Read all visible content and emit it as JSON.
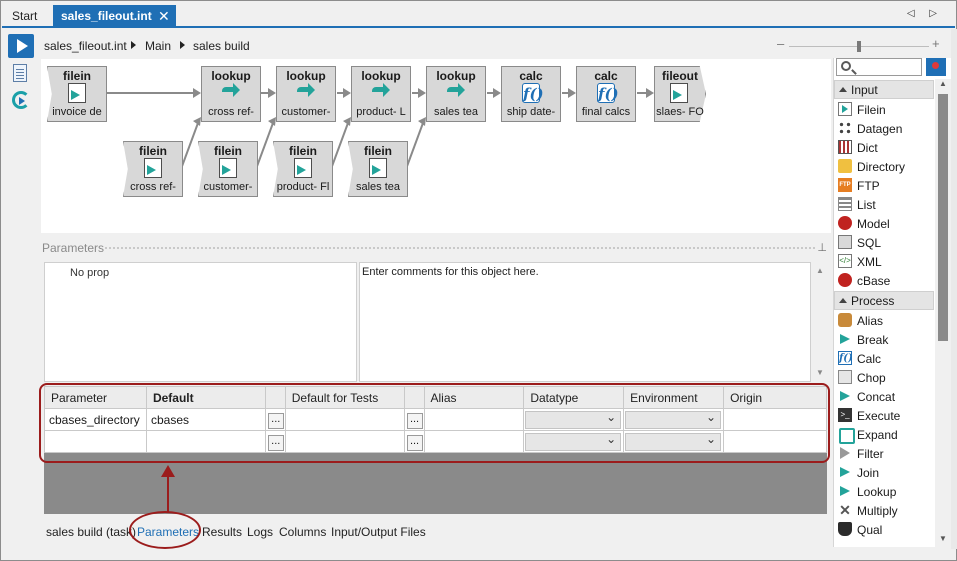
{
  "tabs": {
    "start": "Start",
    "active": "sales_fileout.int",
    "close": "✕",
    "nav": "◁ ▷"
  },
  "breadcrumb": [
    "sales_fileout.int",
    "Main",
    "sales build"
  ],
  "zoom": {
    "minus": "–",
    "plus": "+"
  },
  "graph": {
    "nodes": [
      {
        "id": "n1",
        "type": "filein",
        "title": "filein",
        "label": "invoice de",
        "icon": "file-arrow-icon"
      },
      {
        "id": "n2",
        "type": "lookup",
        "title": "lookup",
        "label": "cross ref-",
        "icon": "lookup-arrow-icon"
      },
      {
        "id": "n3",
        "type": "lookup",
        "title": "lookup",
        "label": "customer-",
        "icon": "lookup-arrow-icon"
      },
      {
        "id": "n4",
        "type": "lookup",
        "title": "lookup",
        "label": "product- L",
        "icon": "lookup-arrow-icon"
      },
      {
        "id": "n5",
        "type": "lookup",
        "title": "lookup",
        "label": "sales tea",
        "icon": "lookup-arrow-icon"
      },
      {
        "id": "n6",
        "type": "calc",
        "title": "calc",
        "label": "ship date-",
        "icon": "calc-fx-icon",
        "glyph": "f()"
      },
      {
        "id": "n7",
        "type": "calc",
        "title": "calc",
        "label": "final calcs",
        "icon": "calc-fx-icon",
        "glyph": "f()"
      },
      {
        "id": "n8",
        "type": "fileout",
        "title": "fileout",
        "label": "slaes- FO",
        "icon": "file-arrow-icon"
      },
      {
        "id": "n9",
        "type": "filein",
        "title": "filein",
        "label": "cross ref-",
        "icon": "file-arrow-icon"
      },
      {
        "id": "n10",
        "type": "filein",
        "title": "filein",
        "label": "customer-",
        "icon": "file-arrow-icon"
      },
      {
        "id": "n11",
        "type": "filein",
        "title": "filein",
        "label": "product- Fl",
        "icon": "file-arrow-icon"
      },
      {
        "id": "n12",
        "type": "filein",
        "title": "filein",
        "label": "sales tea",
        "icon": "file-arrow-icon"
      }
    ]
  },
  "parameters_panel": {
    "header": "Parameters",
    "no_props": "No prop",
    "comment": "Enter comments for this object here."
  },
  "grid": {
    "columns": [
      "Parameter",
      "Default",
      "",
      "Default for Tests",
      "",
      "Alias",
      "Datatype",
      "Environment",
      "Origin"
    ],
    "rows": [
      {
        "parameter": "cbases_directory",
        "default": "cbases",
        "ellipsis": "...",
        "tests": "",
        "alias": "",
        "origin": ""
      },
      {
        "parameter": "",
        "default": "",
        "ellipsis": "...",
        "tests": "",
        "alias": "",
        "origin": ""
      }
    ]
  },
  "bottom_tabs": [
    "sales build (task)",
    "Parameters",
    "Results",
    "Logs",
    "Columns",
    "Input/Output Files"
  ],
  "palette": {
    "search_placeholder": "",
    "categories": [
      {
        "name": "Input",
        "items": [
          {
            "label": "Filein",
            "icon": "filein-icon"
          },
          {
            "label": "Datagen",
            "icon": "datagen-icon"
          },
          {
            "label": "Dict",
            "icon": "dict-icon"
          },
          {
            "label": "Directory",
            "icon": "directory-icon"
          },
          {
            "label": "FTP",
            "icon": "ftp-icon"
          },
          {
            "label": "List",
            "icon": "list-icon"
          },
          {
            "label": "Model",
            "icon": "model-icon"
          },
          {
            "label": "SQL",
            "icon": "sql-icon"
          },
          {
            "label": "XML",
            "icon": "xml-icon"
          },
          {
            "label": "cBase",
            "icon": "cbase-icon"
          }
        ]
      },
      {
        "name": "Process",
        "items": [
          {
            "label": "Alias",
            "icon": "alias-icon"
          },
          {
            "label": "Break",
            "icon": "break-icon"
          },
          {
            "label": "Calc",
            "icon": "calc-icon"
          },
          {
            "label": "Chop",
            "icon": "chop-icon"
          },
          {
            "label": "Concat",
            "icon": "concat-icon"
          },
          {
            "label": "Execute",
            "icon": "execute-icon"
          },
          {
            "label": "Expand",
            "icon": "expand-icon"
          },
          {
            "label": "Filter",
            "icon": "filter-icon"
          },
          {
            "label": "Join",
            "icon": "join-icon"
          },
          {
            "label": "Lookup",
            "icon": "lookup-icon"
          },
          {
            "label": "Multiply",
            "icon": "multiply-icon"
          },
          {
            "label": "Qual",
            "icon": "qual-icon"
          }
        ]
      }
    ]
  },
  "colors": {
    "accent": "#1f6fb5",
    "annotation": "#9b1c1c",
    "node_fill": "#d8d8d8",
    "teal": "#23a39a"
  }
}
